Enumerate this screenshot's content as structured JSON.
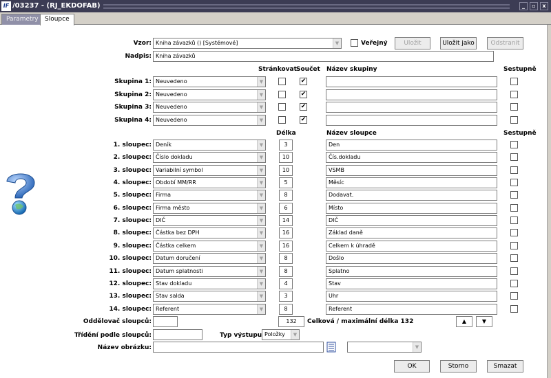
{
  "window": {
    "title": "/03237 - (RJ_EKDOFAB)",
    "logo": "IF",
    "minimize": "_",
    "restore": "▫",
    "close": "x"
  },
  "tabs": [
    {
      "label": "Parametry"
    },
    {
      "label": "Sloupce"
    }
  ],
  "top": {
    "vzor_label": "Vzor:",
    "vzor_value": "Kniha závazků  ()  [Systémové]",
    "verejny_label": "Veřejný",
    "ulozit": "Uložit",
    "ulozit_jako": "Uložit jako",
    "odstranit": "Odstranit",
    "nadpis_label": "Nadpis:",
    "nadpis_value": "Kniha závazků"
  },
  "group_headers": {
    "strankovat": "Stránkovat",
    "soucet": "Součet",
    "nazev_skupiny": "Název skupiny",
    "sestupne": "Sestupně"
  },
  "groups": [
    {
      "label": "Skupina 1:",
      "value": "Neuvedeno",
      "strankovat": false,
      "soucet": true,
      "nazev": "",
      "sestupne": false
    },
    {
      "label": "Skupina 2:",
      "value": "Neuvedeno",
      "strankovat": false,
      "soucet": true,
      "nazev": "",
      "sestupne": false
    },
    {
      "label": "Skupina 3:",
      "value": "Neuvedeno",
      "strankovat": false,
      "soucet": true,
      "nazev": "",
      "sestupne": false
    },
    {
      "label": "Skupina 4:",
      "value": "Neuvedeno",
      "strankovat": false,
      "soucet": true,
      "nazev": "",
      "sestupne": false
    }
  ],
  "column_headers": {
    "delka": "Délka",
    "nazev_sloupce": "Název sloupce",
    "sestupne": "Sestupně"
  },
  "columns": [
    {
      "label": "1. sloupec:",
      "value": "Deník",
      "delka": "3",
      "nazev": "Den",
      "sestupne": false
    },
    {
      "label": "2. sloupec:",
      "value": "Číslo dokladu",
      "delka": "10",
      "nazev": "Čís.dokladu",
      "sestupne": false
    },
    {
      "label": "3. sloupec:",
      "value": "Variabilní symbol",
      "delka": "10",
      "nazev": "VSMB",
      "sestupne": false
    },
    {
      "label": "4. sloupec:",
      "value": "Období MM/RR",
      "delka": "5",
      "nazev": "Měsíc",
      "sestupne": false
    },
    {
      "label": "5. sloupec:",
      "value": "Firma",
      "delka": "8",
      "nazev": "Dodavat.",
      "sestupne": false
    },
    {
      "label": "6. sloupec:",
      "value": "Firma město",
      "delka": "6",
      "nazev": "Místo",
      "sestupne": false
    },
    {
      "label": "7. sloupec:",
      "value": "DIČ",
      "delka": "14",
      "nazev": "DIČ",
      "sestupne": false
    },
    {
      "label": "8. sloupec:",
      "value": "Částka bez DPH",
      "delka": "16",
      "nazev": "Základ daně",
      "sestupne": false
    },
    {
      "label": "9. sloupec:",
      "value": "Částka celkem",
      "delka": "16",
      "nazev": "Celkem k úhradě",
      "sestupne": false
    },
    {
      "label": "10. sloupec:",
      "value": "Datum doručení",
      "delka": "8",
      "nazev": "Došlo",
      "sestupne": false
    },
    {
      "label": "11. sloupec:",
      "value": "Datum splatnosti",
      "delka": "8",
      "nazev": "Splatno",
      "sestupne": false
    },
    {
      "label": "12. sloupec:",
      "value": "Stav dokladu",
      "delka": "4",
      "nazev": "Stav",
      "sestupne": false
    },
    {
      "label": "13. sloupec:",
      "value": "Stav salda",
      "delka": "3",
      "nazev": "Uhr",
      "sestupne": false
    },
    {
      "label": "14. sloupec:",
      "value": "Referent",
      "delka": "8",
      "nazev": "Referent",
      "sestupne": false
    }
  ],
  "bottom": {
    "oddelovac_label": "Oddělovač sloupců:",
    "oddelovac_value": "",
    "celkova_value": "132",
    "celkova_label": "Celková / maximální délka 132",
    "trideni_label": "Třídění podle sloupců:",
    "trideni_value": "",
    "typ_label": "Typ výstupu:",
    "typ_value": "Položky",
    "obrazek_label": "Název obrázku:",
    "obrazek_value": "",
    "obrazek_combo": "",
    "up_arrow": "▲",
    "down_arrow": "▼"
  },
  "footer": {
    "ok": "OK",
    "storno": "Storno",
    "smazat": "Smazat"
  },
  "colors": {
    "titlebar": "#3c3c54",
    "tab_inactive": "#9090a8",
    "help_icon": "#3a7ac8"
  },
  "icons": {
    "help": "help-question-icon",
    "checkmark": "✔",
    "dropdown": "▼"
  }
}
